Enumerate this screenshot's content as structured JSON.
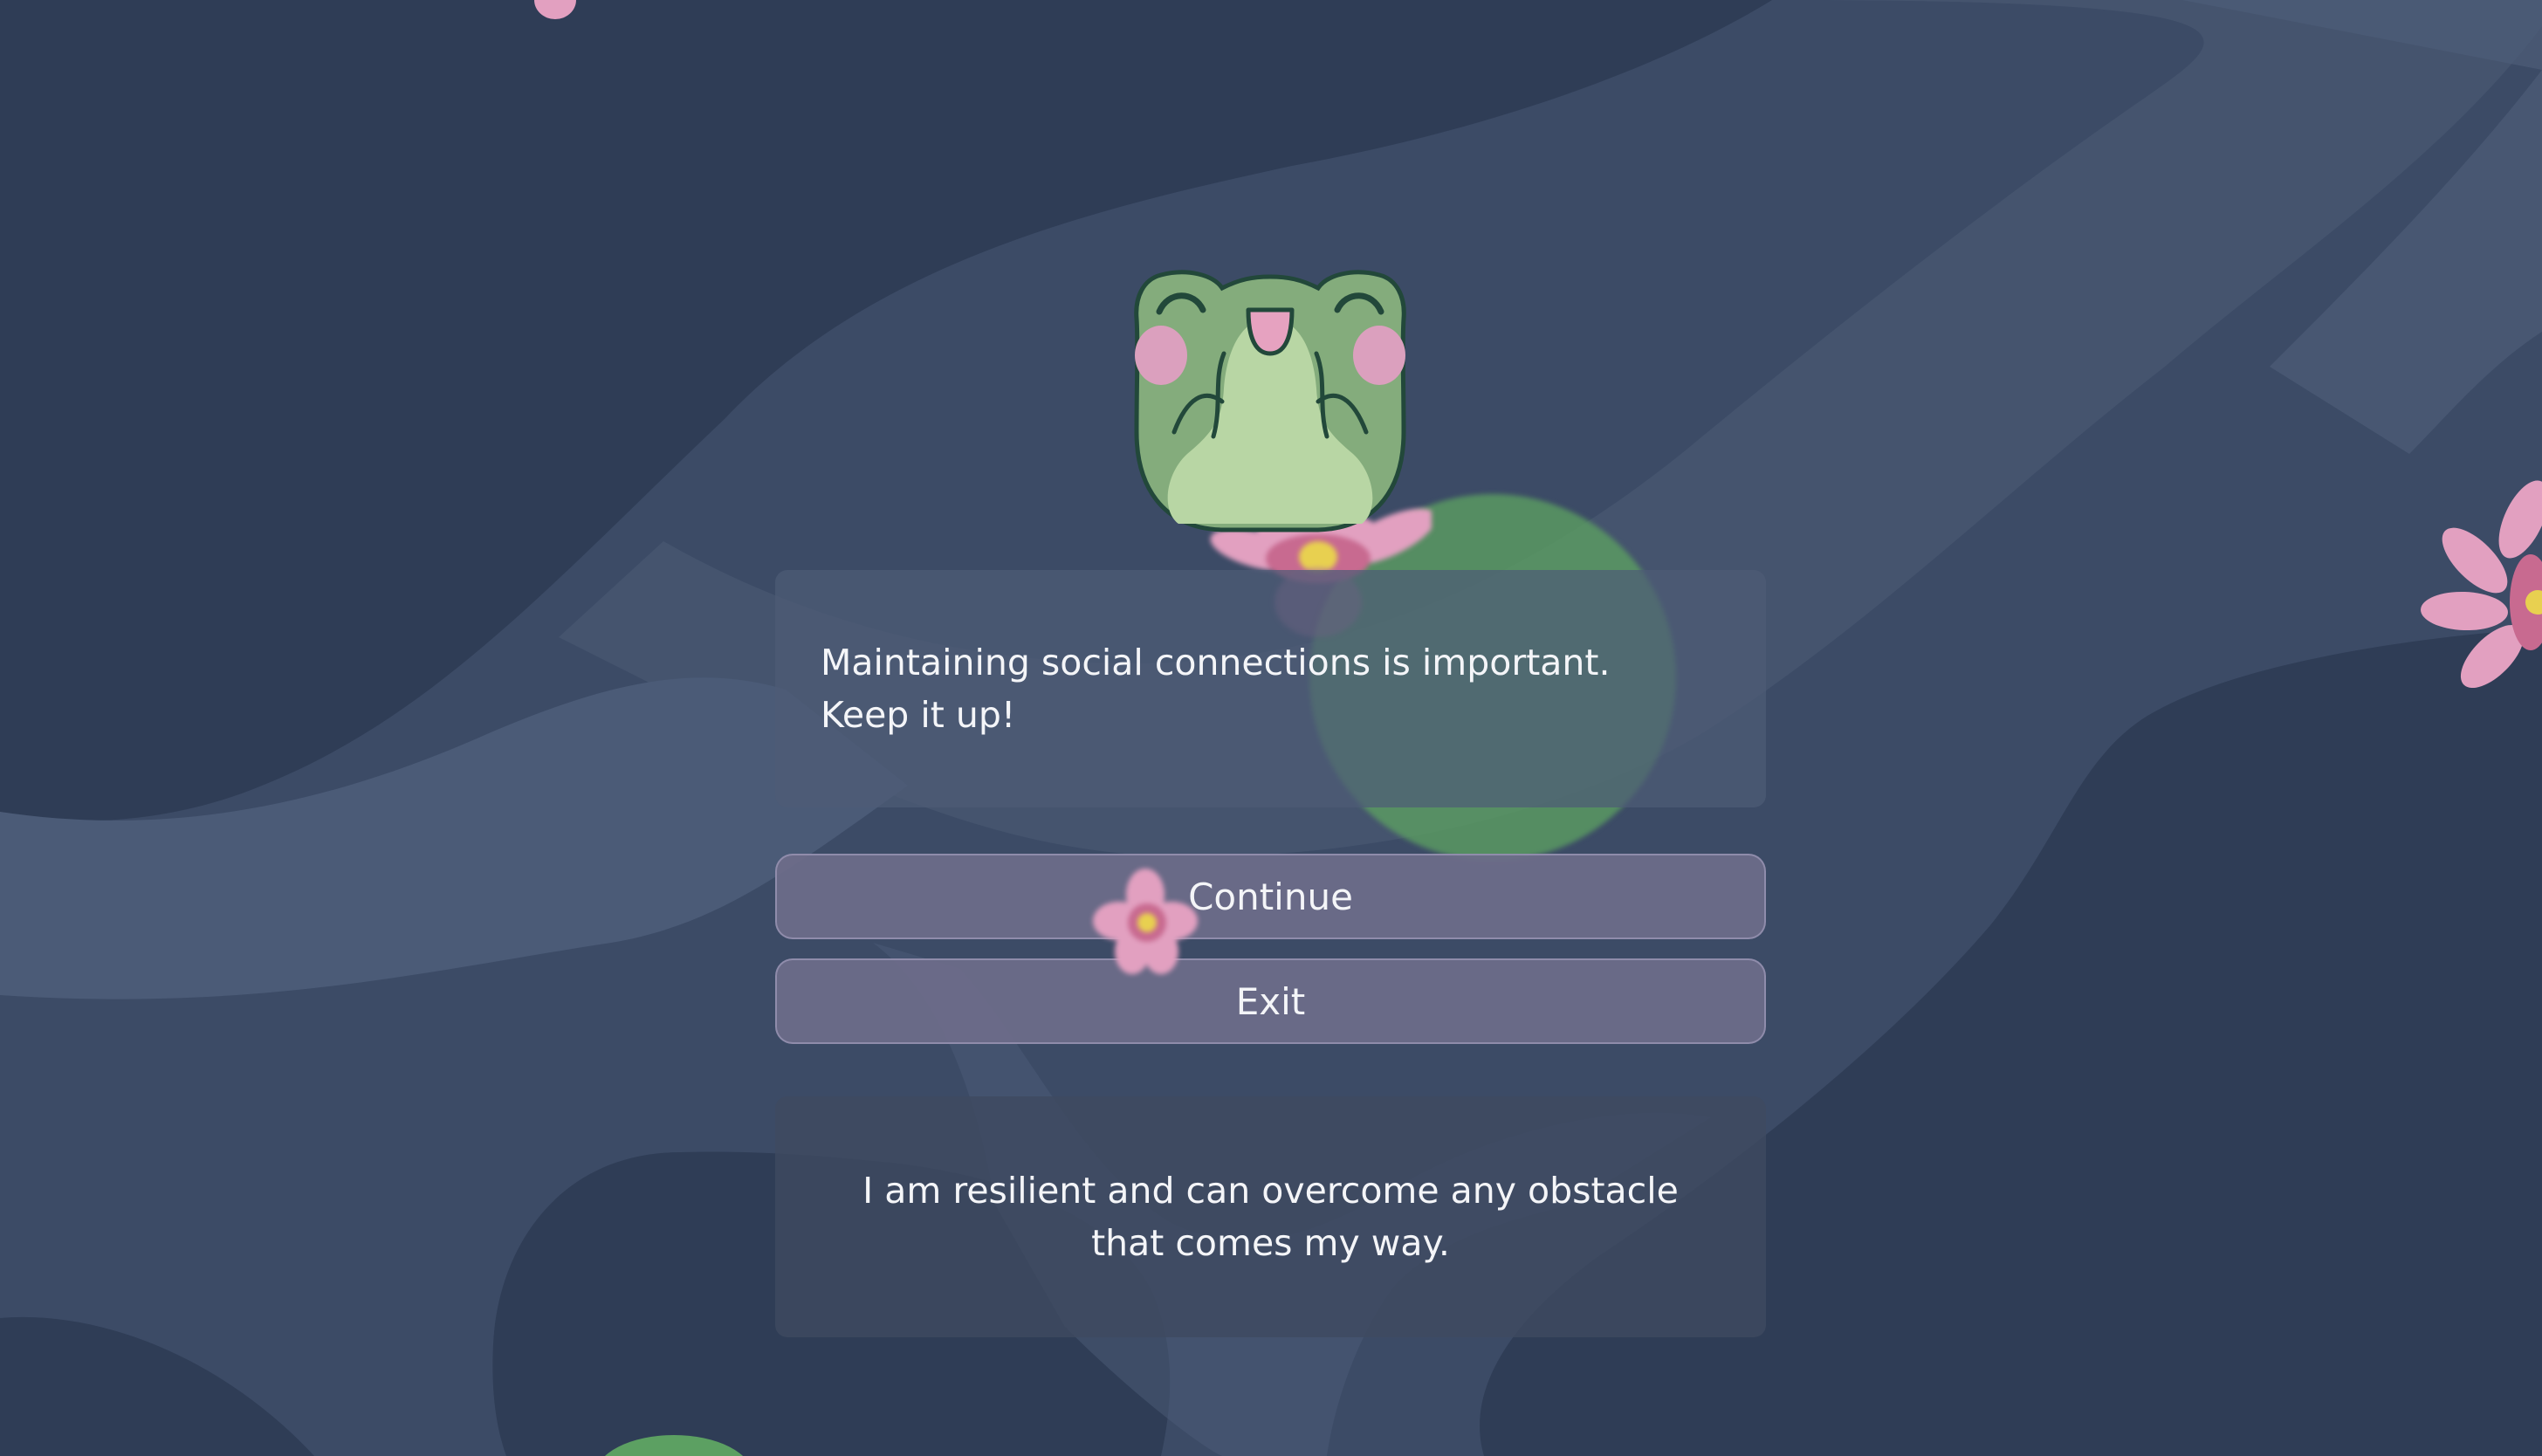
{
  "message": {
    "text": "Maintaining social connections is important.\nKeep it up!"
  },
  "buttons": {
    "continue_label": "Continue",
    "exit_label": "Exit"
  },
  "affirmation": {
    "text": "I am resilient and can overcome any obstacle that comes my way."
  },
  "colors": {
    "background": "#3a4a64",
    "lily_pad": "#5ca062",
    "flower_petal": "#e2a0c0",
    "flower_center": "#e8d050",
    "frog_body": "#84ac7c",
    "frog_belly": "#b8d6a4"
  },
  "icons": {
    "mascot": "frog-mascot-icon",
    "flower": "lotus-flower-icon",
    "lily_pad": "lily-pad-icon"
  }
}
